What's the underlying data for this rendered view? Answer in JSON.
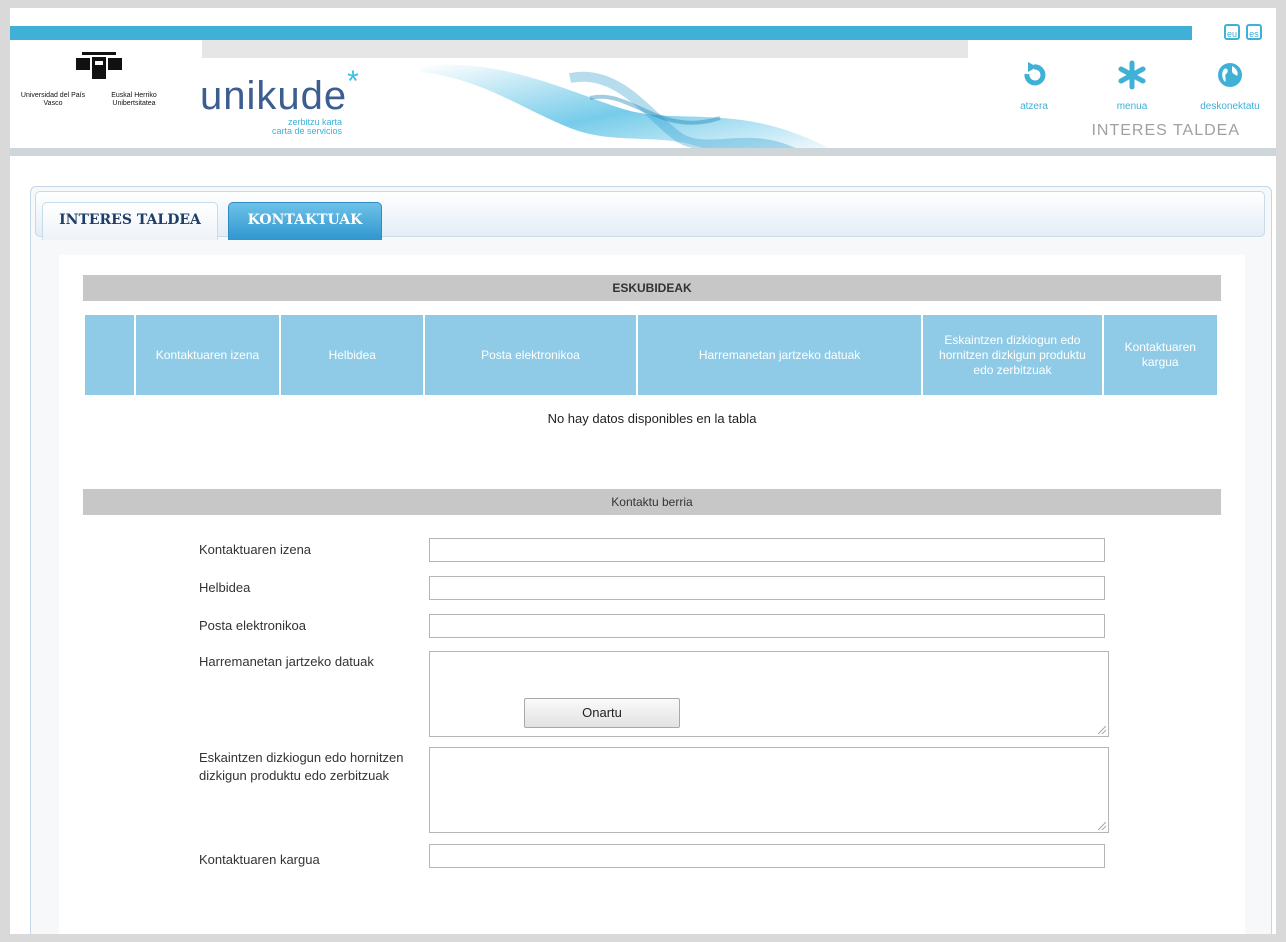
{
  "header": {
    "languages": [
      "eu",
      "es"
    ],
    "institution": {
      "left_text": "Universidad del País Vasco",
      "right_text": "Euskal Herriko Unibertsitatea"
    },
    "brand": {
      "name": "unikude",
      "star": "*",
      "subtitle_line1": "zerbitzu karta",
      "subtitle_line2": "carta de servicios"
    },
    "nav": [
      {
        "label": "atzera",
        "icon": "back-arrow-icon"
      },
      {
        "label": "menua",
        "icon": "snowflake-menu-icon"
      },
      {
        "label": "deskonektatu",
        "icon": "globe-icon"
      }
    ],
    "section_title": "INTERES TALDEA",
    "accent_color": "#3fb0d6"
  },
  "tabs": [
    {
      "label": "INTERES TALDEA",
      "active": false
    },
    {
      "label": "KONTAKTUAK",
      "active": true
    }
  ],
  "rights": {
    "title": "ESKUBIDEAK",
    "columns": [
      "",
      "Kontaktuaren izena",
      "Helbidea",
      "Posta elektronikoa",
      "Harremanetan jartzeko datuak",
      "Eskaintzen dizkiogun edo hornitzen dizkigun produktu edo zerbitzuak",
      "Kontaktuaren kargua"
    ],
    "empty_message": "No hay datos disponibles en la tabla"
  },
  "form": {
    "title": "Kontaktu berria",
    "fields": {
      "name": {
        "label": "Kontaktuaren izena",
        "value": ""
      },
      "address": {
        "label": "Helbidea",
        "value": ""
      },
      "email": {
        "label": "Posta elektronikoa",
        "value": ""
      },
      "contact_data": {
        "label": "Harremanetan jartzeko datuak",
        "value": ""
      },
      "products": {
        "label": "Eskaintzen dizkiogun edo hornitzen dizkigun produktu edo zerbitzuak",
        "value": ""
      },
      "role": {
        "label": "Kontaktuaren kargua",
        "value": ""
      }
    },
    "submit_label": "Onartu"
  }
}
